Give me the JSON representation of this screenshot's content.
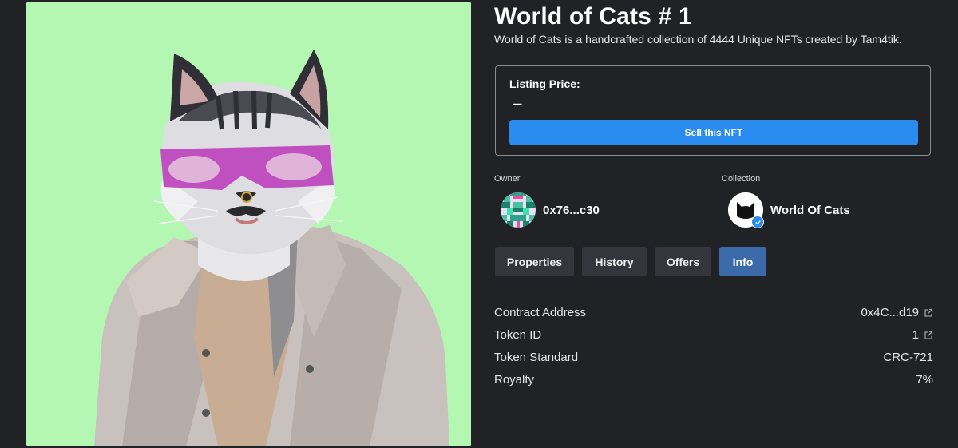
{
  "nft": {
    "title": "World of Cats # 1",
    "description": "World of Cats is a handcrafted collection of 4444 Unique NFTs created by Tam4tik."
  },
  "listing": {
    "label": "Listing Price:",
    "price": "–",
    "sell_label": "Sell this NFT"
  },
  "owner": {
    "label": "Owner",
    "address": "0x76...c30"
  },
  "collection": {
    "label": "Collection",
    "name": "World Of Cats",
    "verified": true
  },
  "tabs": [
    {
      "label": "Properties",
      "active": false
    },
    {
      "label": "History",
      "active": false
    },
    {
      "label": "Offers",
      "active": false
    },
    {
      "label": "Info",
      "active": true
    }
  ],
  "info": [
    {
      "key": "Contract Address",
      "value": "0x4C...d19",
      "external_link": true
    },
    {
      "key": "Token ID",
      "value": "1",
      "external_link": true
    },
    {
      "key": "Token Standard",
      "value": "CRC-721",
      "external_link": false
    },
    {
      "key": "Royalty",
      "value": "7%",
      "external_link": false
    }
  ],
  "colors": {
    "background": "#202226",
    "artwork_background": "#b3f7b3",
    "accent_blue": "#2b8cf0",
    "active_tab": "#3b6aa8",
    "tab": "#34363b"
  }
}
